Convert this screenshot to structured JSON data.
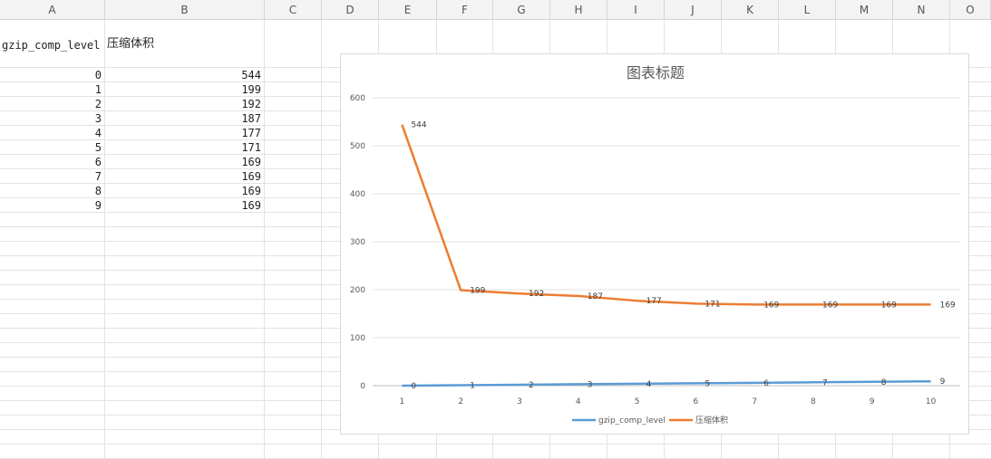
{
  "sheet": {
    "columns": [
      "A",
      "B",
      "C",
      "D",
      "E",
      "F",
      "G",
      "H",
      "I",
      "J",
      "K",
      "L",
      "M",
      "N",
      "O"
    ],
    "header_a": "gzip_comp_level",
    "header_b": "压缩体积",
    "col_a": [
      "0",
      "1",
      "2",
      "3",
      "4",
      "5",
      "6",
      "7",
      "8",
      "9"
    ],
    "col_b": [
      "544",
      "199",
      "192",
      "187",
      "177",
      "171",
      "169",
      "169",
      "169",
      "169"
    ]
  },
  "chart_data": {
    "type": "line",
    "title": "图表标题",
    "categories": [
      "1",
      "2",
      "3",
      "4",
      "5",
      "6",
      "7",
      "8",
      "9",
      "10"
    ],
    "series": [
      {
        "name": "gzip_comp_level",
        "color": "#5b9bd5",
        "values": [
          0,
          1,
          2,
          3,
          4,
          5,
          6,
          7,
          8,
          9
        ]
      },
      {
        "name": "压缩体积",
        "color": "#ed7d31",
        "values": [
          544,
          199,
          192,
          187,
          177,
          171,
          169,
          169,
          169,
          169
        ]
      }
    ],
    "ylim": [
      0,
      600
    ],
    "yticks": [
      0,
      100,
      200,
      300,
      400,
      500,
      600
    ],
    "grid": true,
    "legend": "bottom"
  }
}
